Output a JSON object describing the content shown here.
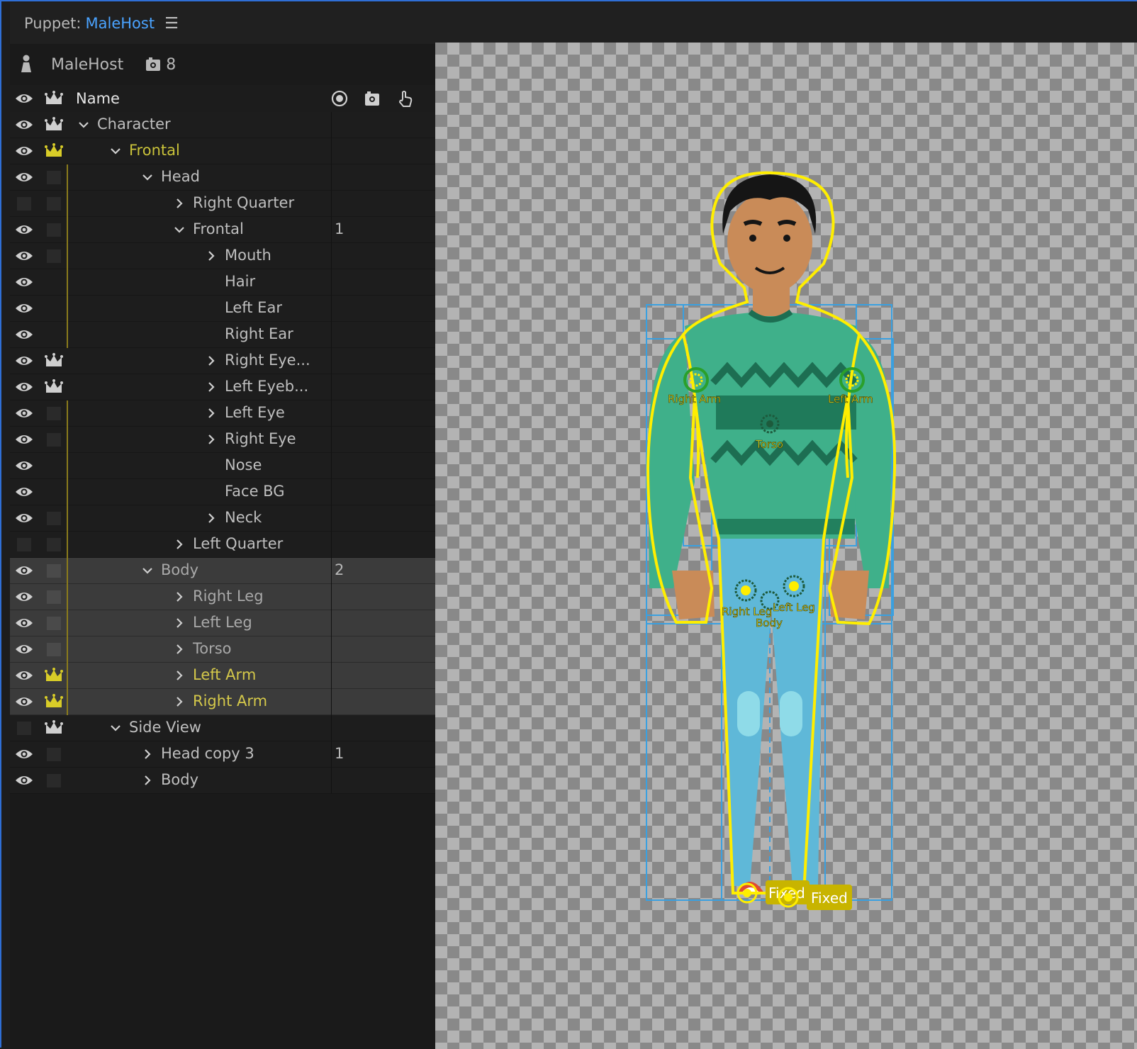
{
  "header": {
    "prefix": "Puppet:",
    "puppet_name": "MaleHost",
    "menu_icon": "hamburger-icon"
  },
  "puppet_row": {
    "name": "MaleHost",
    "camera_icon": "camera-icon",
    "count": "8"
  },
  "tree_header": {
    "name_label": "Name"
  },
  "rows": [
    {
      "label": "Character",
      "eye": true,
      "crown": "white",
      "box": false,
      "indent": 0,
      "arrow": "down",
      "num": "",
      "sel": false,
      "yellow": false,
      "vline": false
    },
    {
      "label": "Frontal",
      "eye": true,
      "crown": "yellow",
      "box": false,
      "indent": 1,
      "arrow": "down",
      "num": "",
      "sel": false,
      "yellow": true,
      "vline": false
    },
    {
      "label": "Head",
      "eye": true,
      "crown": "",
      "box": true,
      "indent": 2,
      "arrow": "down",
      "num": "",
      "sel": false,
      "yellow": false,
      "vline": true
    },
    {
      "label": "Right Quarter",
      "eye": false,
      "crown": "",
      "box": true,
      "indent": 3,
      "arrow": "right",
      "num": "",
      "sel": false,
      "yellow": false,
      "vline": true
    },
    {
      "label": "Frontal",
      "eye": true,
      "crown": "",
      "box": true,
      "indent": 3,
      "arrow": "down",
      "num": "1",
      "sel": false,
      "yellow": false,
      "vline": true
    },
    {
      "label": "Mouth",
      "eye": true,
      "crown": "",
      "box": true,
      "indent": 4,
      "arrow": "right",
      "num": "",
      "sel": false,
      "yellow": false,
      "vline": true
    },
    {
      "label": "Hair",
      "eye": true,
      "crown": "",
      "box": false,
      "indent": 4,
      "arrow": "",
      "num": "",
      "sel": false,
      "yellow": false,
      "vline": true
    },
    {
      "label": "Left Ear",
      "eye": true,
      "crown": "",
      "box": false,
      "indent": 4,
      "arrow": "",
      "num": "",
      "sel": false,
      "yellow": false,
      "vline": true
    },
    {
      "label": "Right Ear",
      "eye": true,
      "crown": "",
      "box": false,
      "indent": 4,
      "arrow": "",
      "num": "",
      "sel": false,
      "yellow": false,
      "vline": true
    },
    {
      "label": "Right Eye...",
      "eye": true,
      "crown": "white",
      "box": false,
      "indent": 4,
      "arrow": "right",
      "num": "",
      "sel": false,
      "yellow": false,
      "vline": false
    },
    {
      "label": "Left Eyeb...",
      "eye": true,
      "crown": "white",
      "box": false,
      "indent": 4,
      "arrow": "right",
      "num": "",
      "sel": false,
      "yellow": false,
      "vline": false
    },
    {
      "label": "Left Eye",
      "eye": true,
      "crown": "",
      "box": true,
      "indent": 4,
      "arrow": "right",
      "num": "",
      "sel": false,
      "yellow": false,
      "vline": true
    },
    {
      "label": "Right Eye",
      "eye": true,
      "crown": "",
      "box": true,
      "indent": 4,
      "arrow": "right",
      "num": "",
      "sel": false,
      "yellow": false,
      "vline": true
    },
    {
      "label": "Nose",
      "eye": true,
      "crown": "",
      "box": false,
      "indent": 4,
      "arrow": "",
      "num": "",
      "sel": false,
      "yellow": false,
      "vline": true
    },
    {
      "label": "Face BG",
      "eye": true,
      "crown": "",
      "box": false,
      "indent": 4,
      "arrow": "",
      "num": "",
      "sel": false,
      "yellow": false,
      "vline": true
    },
    {
      "label": "Neck",
      "eye": true,
      "crown": "",
      "box": true,
      "indent": 4,
      "arrow": "right",
      "num": "",
      "sel": false,
      "yellow": false,
      "vline": true
    },
    {
      "label": "Left Quarter",
      "eye": false,
      "crown": "",
      "box": true,
      "indent": 3,
      "arrow": "right",
      "num": "",
      "sel": false,
      "yellow": false,
      "vline": true
    },
    {
      "label": "Body",
      "eye": true,
      "crown": "",
      "box": true,
      "indent": 2,
      "arrow": "down",
      "num": "2",
      "sel": true,
      "yellow": false,
      "vline": true
    },
    {
      "label": "Right Leg",
      "eye": true,
      "crown": "",
      "box": true,
      "indent": 3,
      "arrow": "right",
      "num": "",
      "sel": true,
      "yellow": false,
      "vline": true
    },
    {
      "label": "Left Leg",
      "eye": true,
      "crown": "",
      "box": true,
      "indent": 3,
      "arrow": "right",
      "num": "",
      "sel": true,
      "yellow": false,
      "vline": true
    },
    {
      "label": "Torso",
      "eye": true,
      "crown": "",
      "box": true,
      "indent": 3,
      "arrow": "right",
      "num": "",
      "sel": true,
      "yellow": false,
      "vline": true
    },
    {
      "label": "Left Arm",
      "eye": true,
      "crown": "yellow",
      "box": false,
      "indent": 3,
      "arrow": "right",
      "num": "",
      "sel": true,
      "yellow": true,
      "vline": true
    },
    {
      "label": "Right Arm",
      "eye": true,
      "crown": "yellow",
      "box": false,
      "indent": 3,
      "arrow": "right",
      "num": "",
      "sel": true,
      "yellow": true,
      "vline": true
    },
    {
      "label": "Side View",
      "eye": false,
      "crown": "white",
      "box": false,
      "indent": 1,
      "arrow": "down",
      "num": "",
      "sel": false,
      "yellow": false,
      "vline": false
    },
    {
      "label": "Head copy 3",
      "eye": true,
      "crown": "",
      "box": true,
      "indent": 2,
      "arrow": "right",
      "num": "1",
      "sel": false,
      "yellow": false,
      "vline": false
    },
    {
      "label": "Body",
      "eye": true,
      "crown": "",
      "box": true,
      "indent": 2,
      "arrow": "right",
      "num": "",
      "sel": false,
      "yellow": false,
      "vline": false
    }
  ],
  "canvas": {
    "handle_labels": {
      "right_arm": "Right Arm",
      "left_arm": "Left Arm",
      "torso": "Torso",
      "right_leg": "Right Leg",
      "left_leg": "Left Leg",
      "body": "Body",
      "fixed_1": "Fixed",
      "fixed_2": "Fixed"
    }
  },
  "colors": {
    "accent_blue": "#4aa3ff",
    "crown_yellow": "#d8cc28",
    "outline_yellow": "#ffee00",
    "bbox_blue": "#3aa0e0",
    "sweater": "#3fb08a",
    "jeans": "#5fb8d8"
  }
}
